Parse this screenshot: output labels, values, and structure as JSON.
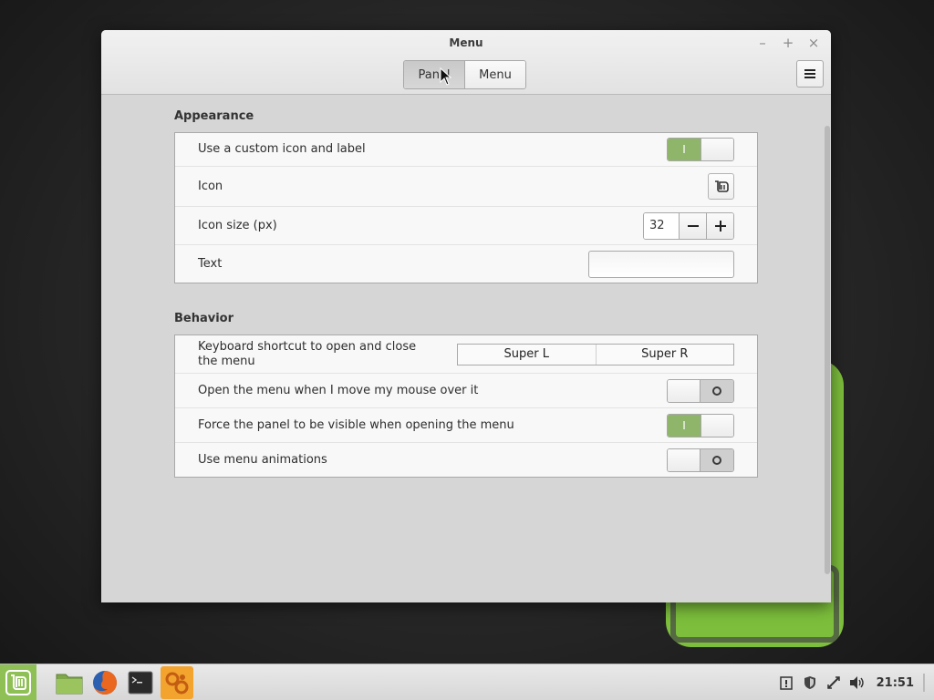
{
  "window": {
    "title": "Menu",
    "minimize": "–",
    "maximize": "+",
    "close": "×"
  },
  "tabs": [
    {
      "label": "Panel",
      "active": true
    },
    {
      "label": "Menu",
      "active": false
    }
  ],
  "appearance": {
    "heading": "Appearance",
    "custom_icon_label": "Use a custom icon and label",
    "custom_icon_state": "on",
    "icon_label": "Icon",
    "icon_size_label": "Icon size (px)",
    "icon_size_value": "32",
    "text_label": "Text",
    "text_value": ""
  },
  "behavior": {
    "heading": "Behavior",
    "shortcut_label": "Keyboard shortcut to open and close the menu",
    "shortcut_primary": "Super L",
    "shortcut_secondary": "Super R",
    "hover_open_label": "Open the menu when I move my mouse over it",
    "hover_open_state": "off",
    "force_panel_label": "Force the panel to be visible when opening the menu",
    "force_panel_state": "on",
    "animations_label": "Use menu animations",
    "animations_state": "off"
  },
  "switch_glyphs": {
    "on": "I",
    "off": "O"
  },
  "taskbar": {
    "launchers": [
      "files-icon",
      "firefox-icon",
      "terminal-icon",
      "settings-icon"
    ],
    "clock": "21:51"
  },
  "colors": {
    "accent_green": "#8fb56a",
    "active_launcher": "#f3a42f",
    "mint_green": "#8fc056"
  }
}
